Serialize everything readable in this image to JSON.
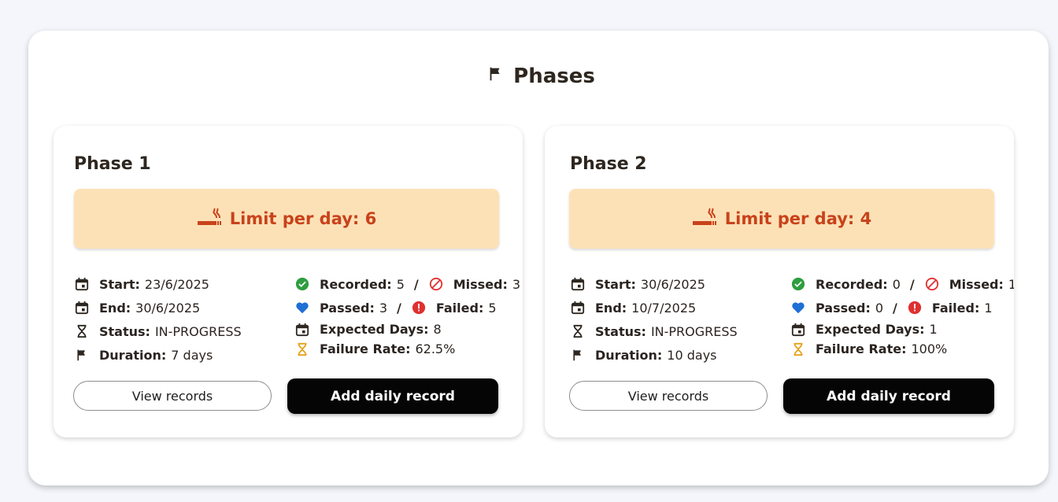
{
  "heading": {
    "title": "Phases",
    "icon": "flag-icon"
  },
  "colors": {
    "limit_bg": "#fde1b6",
    "limit_text": "#c8421b",
    "recorded": "#2e9e3e",
    "missed": "#e03030",
    "passed": "#1e6fd6",
    "failed": "#e03030",
    "failure_rate": "#e6a11a"
  },
  "phases": [
    {
      "title": "Phase 1",
      "limit": "Limit per day: 6",
      "start_label": "Start:",
      "start": "23/6/2025",
      "end_label": "End:",
      "end": "30/6/2025",
      "status_label": "Status:",
      "status": "IN-PROGRESS",
      "duration_label": "Duration:",
      "duration": "7 days",
      "recorded_label": "Recorded:",
      "recorded": "5",
      "missed_label": "Missed:",
      "missed": "3",
      "passed_label": "Passed:",
      "passed": "3",
      "failed_label": "Failed:",
      "failed": "5",
      "expected_label": "Expected Days:",
      "expected": "8",
      "failure_rate_label": "Failure Rate:",
      "failure_rate": "62.5%",
      "view_button": "View records",
      "add_button": "Add daily record"
    },
    {
      "title": "Phase 2",
      "limit": "Limit per day: 4",
      "start_label": "Start:",
      "start": "30/6/2025",
      "end_label": "End:",
      "end": "10/7/2025",
      "status_label": "Status:",
      "status": "IN-PROGRESS",
      "duration_label": "Duration:",
      "duration": "10 days",
      "recorded_label": "Recorded:",
      "recorded": "0",
      "missed_label": "Missed:",
      "missed": "1",
      "passed_label": "Passed:",
      "passed": "0",
      "failed_label": "Failed:",
      "failed": "1",
      "expected_label": "Expected Days:",
      "expected": "1",
      "failure_rate_label": "Failure Rate:",
      "failure_rate": "100%",
      "view_button": "View records",
      "add_button": "Add daily record"
    }
  ]
}
